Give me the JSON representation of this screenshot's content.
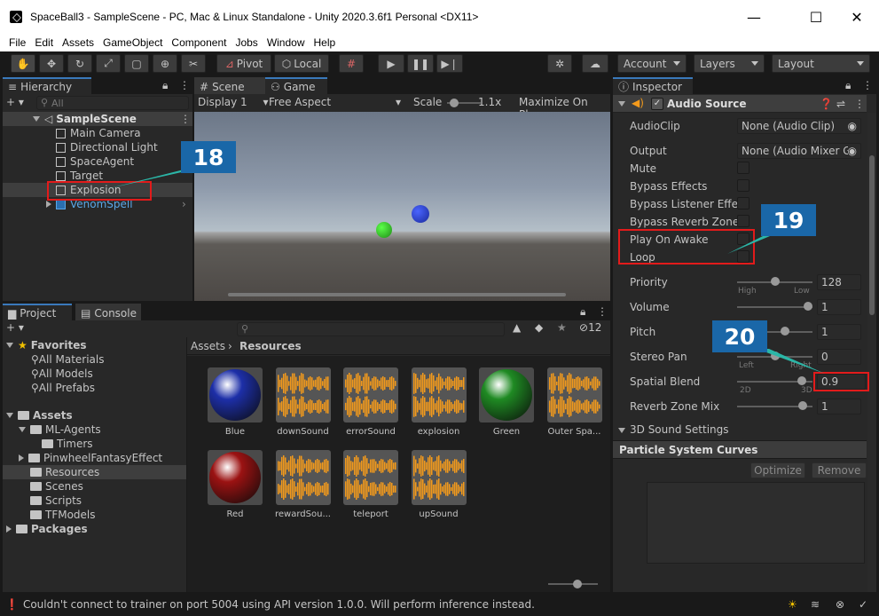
{
  "window": {
    "title": "SpaceBall3 - SampleScene - PC, Mac & Linux Standalone - Unity 2020.3.6f1 Personal <DX11>",
    "minimize": "—",
    "maximize": "☐",
    "close": "✕"
  },
  "menu": [
    "File",
    "Edit",
    "Assets",
    "GameObject",
    "Component",
    "Jobs",
    "Window",
    "Help"
  ],
  "toolbar": {
    "pivot": "Pivot",
    "local": "Local",
    "account": "Account",
    "layers": "Layers",
    "layout": "Layout"
  },
  "hierarchy": {
    "tab": "Hierarchy",
    "search_placeholder": "All",
    "scene": "SampleScene",
    "items": [
      "Main Camera",
      "Directional Light",
      "SpaceAgent",
      "Target",
      "Explosion",
      "VenomSpell"
    ]
  },
  "scene_view": {
    "tabs": [
      "Scene",
      "Game"
    ],
    "display": "Display 1",
    "aspect": "Free Aspect",
    "scale_label": "Scale",
    "scale_value": "1.1x",
    "maximize": "Maximize On Play"
  },
  "inspector": {
    "tab": "Inspector",
    "component": "Audio Source",
    "rows": {
      "audioclip_label": "AudioClip",
      "audioclip_value": "None (Audio Clip)",
      "output_label": "Output",
      "output_value": "None (Audio Mixer Gr",
      "mute": "Mute",
      "bypass_effects": "Bypass Effects",
      "bypass_listener": "Bypass Listener Effec",
      "bypass_reverb": "Bypass Reverb Zones",
      "play_on_awake": "Play On Awake",
      "loop": "Loop",
      "priority_label": "Priority",
      "priority_value": "128",
      "priority_high": "High",
      "priority_low": "Low",
      "volume_label": "Volume",
      "volume_value": "1",
      "pitch_label": "Pitch",
      "pitch_value": "1",
      "stereo_label": "Stereo Pan",
      "stereo_value": "0",
      "stereo_left": "Left",
      "stereo_right": "Right",
      "spatial_label": "Spatial Blend",
      "spatial_value": "0.9",
      "spatial_2d": "2D",
      "spatial_3d": "3D",
      "reverb_label": "Reverb Zone Mix",
      "reverb_value": "1",
      "sound_settings": "3D Sound Settings"
    },
    "particle_curves": "Particle System Curves",
    "optimize": "Optimize",
    "remove": "Remove"
  },
  "project": {
    "tabs": [
      "Project",
      "Console"
    ],
    "hidden_count": "12",
    "breadcrumb_root": "Assets",
    "breadcrumb_current": "Resources",
    "tree": {
      "favorites": "Favorites",
      "fav_items": [
        "All Materials",
        "All Models",
        "All Prefabs"
      ],
      "assets": "Assets",
      "ml_agents": "ML-Agents",
      "timers": "Timers",
      "pinwheel": "PinwheelFantasyEffect",
      "resources": "Resources",
      "scenes": "Scenes",
      "scripts": "Scripts",
      "tfmodels": "TFModels",
      "packages": "Packages"
    },
    "assets": [
      {
        "name": "Blue",
        "kind": "sphere",
        "color": "#1d2fa8"
      },
      {
        "name": "downSound",
        "kind": "audio"
      },
      {
        "name": "errorSound",
        "kind": "audio"
      },
      {
        "name": "explosion",
        "kind": "audio"
      },
      {
        "name": "Green",
        "kind": "sphere",
        "color": "#1f8a23"
      },
      {
        "name": "Outer Spa...",
        "kind": "audio"
      },
      {
        "name": "Red",
        "kind": "sphere",
        "color": "#9b1212"
      },
      {
        "name": "rewardSou...",
        "kind": "audio"
      },
      {
        "name": "teleport",
        "kind": "audio"
      },
      {
        "name": "upSound",
        "kind": "audio"
      }
    ]
  },
  "annotations": {
    "c18": "18",
    "c19": "19",
    "c20": "20"
  },
  "status": {
    "message": "Couldn't connect to trainer on port 5004 using API version 1.0.0. Will perform inference instead."
  },
  "colors": {
    "accent": "#3a79bb",
    "selection": "#2c5d87",
    "callout": "#1a67a8",
    "highlight_box": "#e21b1b",
    "audio_wave": "#f39a1c"
  }
}
